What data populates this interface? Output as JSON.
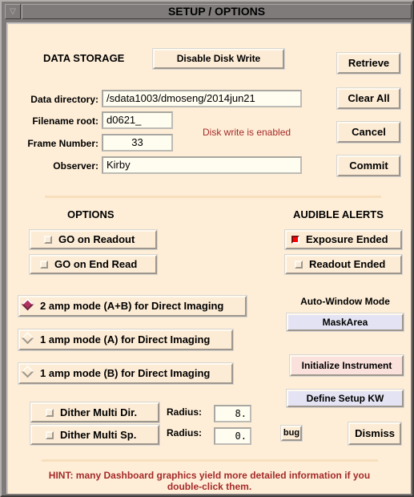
{
  "window": {
    "title": "SETUP / OPTIONS",
    "menu_icon": "triangle-down-icon"
  },
  "data_storage": {
    "heading": "DATA STORAGE",
    "disable_disk_write_label": "Disable Disk Write",
    "data_directory_label": "Data directory:",
    "data_directory_value": "/sdata1003/dmoseng/2014jun21",
    "filename_root_label": "Filename root:",
    "filename_root_value": "d0621_",
    "frame_number_label": "Frame Number:",
    "frame_number_value": "33",
    "observer_label": "Observer:",
    "observer_value": "Kirby",
    "status_text": "Disk write is enabled",
    "status_color": "#a52a2a"
  },
  "side_buttons": {
    "retrieve": "Retrieve",
    "clear_all": "Clear All",
    "cancel": "Cancel",
    "commit": "Commit"
  },
  "options": {
    "heading": "OPTIONS",
    "items": [
      {
        "label": "GO on Readout",
        "checked": false
      },
      {
        "label": "GO on End Read",
        "checked": false
      }
    ]
  },
  "audible_alerts": {
    "heading": "AUDIBLE ALERTS",
    "items": [
      {
        "label": "Exposure Ended",
        "checked": true
      },
      {
        "label": "Readout Ended",
        "checked": false
      }
    ]
  },
  "amp_modes": {
    "items": [
      {
        "label": "2 amp mode (A+B) for Direct Imaging",
        "selected": true
      },
      {
        "label": "1 amp mode (A) for Direct Imaging",
        "selected": false
      },
      {
        "label": "1 amp mode (B) for Direct Imaging",
        "selected": false
      }
    ],
    "selected_color": "#b1325f"
  },
  "auto_window": {
    "label": "Auto-Window Mode",
    "value": "MaskArea"
  },
  "actions": {
    "initialize_instrument": "Initialize Instrument",
    "define_setup_kw": "Define Setup KW",
    "bug": "bug",
    "dismiss": "Dismiss"
  },
  "dither": {
    "items": [
      {
        "label": "Dither Multi Dir.",
        "checked": false,
        "radius_label": "Radius:",
        "radius_value": "8."
      },
      {
        "label": "Dither Multi Sp.",
        "checked": false,
        "radius_label": "Radius:",
        "radius_value": "0."
      }
    ]
  },
  "hint": {
    "line1": "HINT:  many Dashboard graphics yield more detailed information if you",
    "line2": "double-click them."
  },
  "colors": {
    "panel_background": "#feeed7",
    "alert_on": "#ff0000",
    "hint_text": "#a52a2a"
  }
}
